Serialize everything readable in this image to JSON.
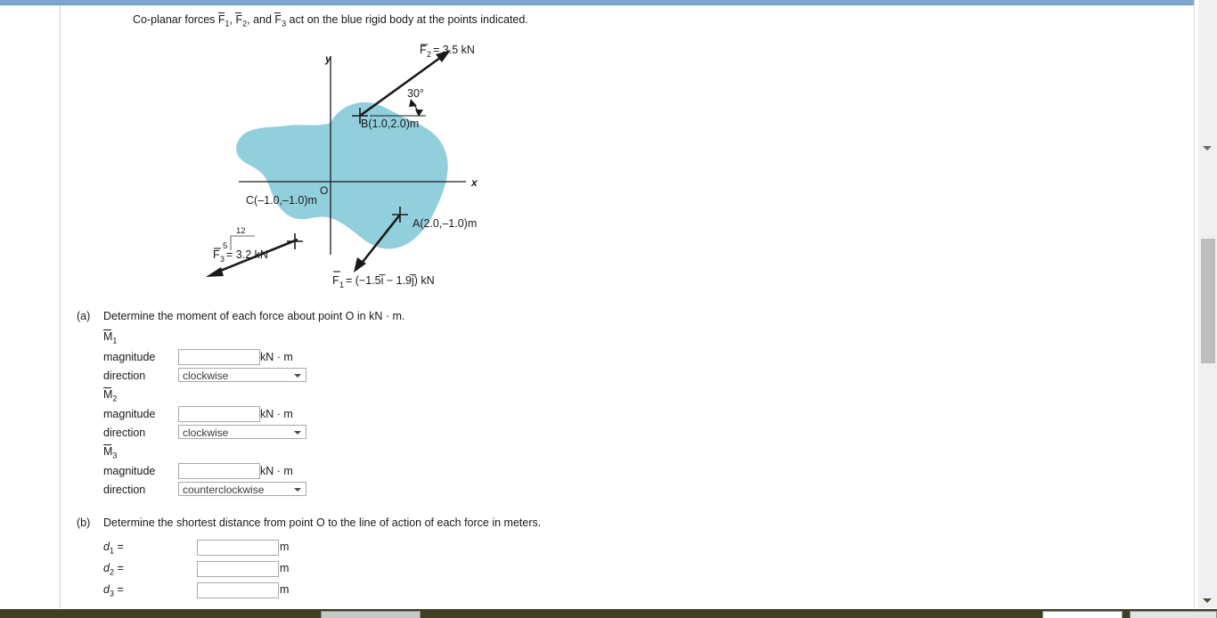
{
  "problem": {
    "stem_pre": "Co-planar forces ",
    "stem_f1": "F",
    "stem_f1_sub": "1",
    "stem_sep1": ", ",
    "stem_f2": "F",
    "stem_f2_sub": "2",
    "stem_sep2": ", and ",
    "stem_f3": "F",
    "stem_f3_sub": "3",
    "stem_post": " act on the blue rigid body at the points indicated."
  },
  "figure": {
    "body_color": "#92cfdd",
    "axis_label_x": "x",
    "axis_label_y": "y",
    "origin_label": "O",
    "points": [
      {
        "id": "A",
        "label": "A(2.0,–1.0)m"
      },
      {
        "id": "B",
        "label": "B(1.0,2.0)m"
      },
      {
        "id": "C",
        "label": "C(–1.0,–1.0)m"
      }
    ],
    "forces": [
      {
        "id": "F1",
        "symbol": "F",
        "sub": "1",
        "label": "= (−1.5i̅ − 1.9j̅) kN"
      },
      {
        "id": "F2",
        "symbol": "F",
        "sub": "2",
        "label": "= 3.5 kN"
      },
      {
        "id": "F3",
        "symbol": "F",
        "sub": "3",
        "label": "= 3.2 kN"
      }
    ],
    "angle_label": "30°",
    "slope_rise": "5",
    "slope_run": "12"
  },
  "part_a": {
    "marker": "(a)",
    "prompt": "Determine the moment of each force about point O in kN · m.",
    "unit": "kN · m",
    "magnitude_label": "magnitude",
    "direction_label": "direction",
    "items": [
      {
        "symbol": "M",
        "sub": "1",
        "magnitude_value": "",
        "direction_value": "clockwise",
        "direction_options": [
          "clockwise",
          "counterclockwise"
        ]
      },
      {
        "symbol": "M",
        "sub": "2",
        "magnitude_value": "",
        "direction_value": "clockwise",
        "direction_options": [
          "clockwise",
          "counterclockwise"
        ]
      },
      {
        "symbol": "M",
        "sub": "3",
        "magnitude_value": "",
        "direction_value": "counterclockwise",
        "direction_options": [
          "clockwise",
          "counterclockwise"
        ]
      }
    ]
  },
  "part_b": {
    "marker": "(b)",
    "prompt": "Determine the shortest distance from point O to the line of action of each force in meters.",
    "unit": "m",
    "items": [
      {
        "symbol": "d",
        "sub": "1",
        "eq": "=",
        "value": ""
      },
      {
        "symbol": "d",
        "sub": "2",
        "eq": "=",
        "value": ""
      },
      {
        "symbol": "d",
        "sub": "3",
        "eq": "=",
        "value": ""
      }
    ]
  }
}
